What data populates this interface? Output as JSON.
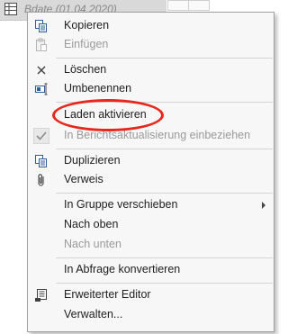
{
  "background": {
    "query_label": "Bdate (01.04.2020)"
  },
  "menu": {
    "items": [
      {
        "label": "Kopieren",
        "icon": "copy-icon",
        "enabled": true
      },
      {
        "label": "Einfügen",
        "icon": "paste-icon",
        "enabled": false
      },
      {
        "label": "Löschen",
        "icon": "delete-x-icon",
        "enabled": true
      },
      {
        "label": "Umbenennen",
        "icon": "rename-icon",
        "enabled": true
      },
      {
        "label": "Laden aktivieren",
        "icon": "",
        "enabled": true,
        "highlighted": true
      },
      {
        "label": "In Berichtsaktualisierung einbeziehen",
        "icon": "checkmark-icon",
        "enabled": false,
        "checked": true
      },
      {
        "label": "Duplizieren",
        "icon": "duplicate-icon",
        "enabled": true
      },
      {
        "label": "Verweis",
        "icon": "paperclip-icon",
        "enabled": true
      },
      {
        "label": "In Gruppe verschieben",
        "icon": "",
        "enabled": true,
        "submenu": true
      },
      {
        "label": "Nach oben",
        "icon": "",
        "enabled": true
      },
      {
        "label": "Nach unten",
        "icon": "",
        "enabled": false
      },
      {
        "label": "In Abfrage konvertieren",
        "icon": "",
        "enabled": true
      },
      {
        "label": "Erweiterter Editor",
        "icon": "advanced-editor-icon",
        "enabled": true
      },
      {
        "label": "Verwalten...",
        "icon": "",
        "enabled": true
      }
    ]
  },
  "colors": {
    "annotation": "#e8261c",
    "disabled_text": "#9a9a9a"
  }
}
